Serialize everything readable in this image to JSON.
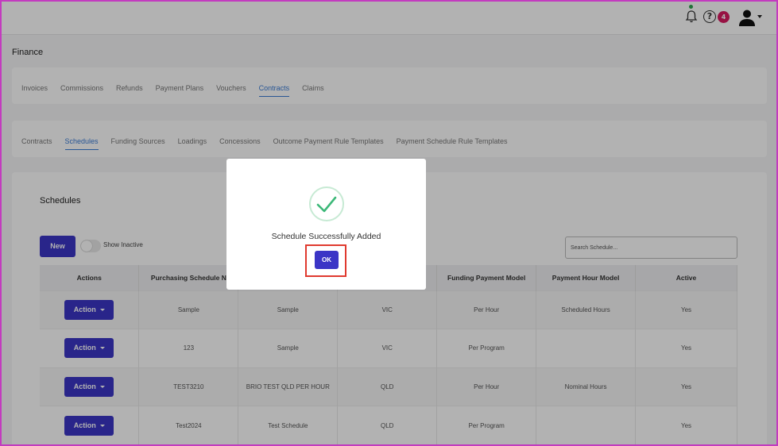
{
  "header": {
    "notification_count": "4"
  },
  "page": {
    "title": "Finance"
  },
  "primary_tabs": [
    {
      "label": "Invoices"
    },
    {
      "label": "Commissions"
    },
    {
      "label": "Refunds"
    },
    {
      "label": "Payment Plans"
    },
    {
      "label": "Vouchers"
    },
    {
      "label": "Contracts",
      "active": true
    },
    {
      "label": "Claims"
    }
  ],
  "secondary_tabs": [
    {
      "label": "Contracts"
    },
    {
      "label": "Schedules",
      "active": true
    },
    {
      "label": "Funding Sources"
    },
    {
      "label": "Loadings"
    },
    {
      "label": "Concessions"
    },
    {
      "label": "Outcome Payment Rule Templates"
    },
    {
      "label": "Payment Schedule Rule Templates"
    }
  ],
  "schedules": {
    "title": "Schedules",
    "new_label": "New",
    "show_inactive_label": "Show Inactive",
    "search_placeholder": "Search Schedule...",
    "columns": [
      "Actions",
      "Purchasing Schedule N",
      "",
      "",
      "Funding Payment Model",
      "Payment Hour Model",
      "Active"
    ],
    "action_label": "Action",
    "rows": [
      [
        "Sample",
        "Sample",
        "VIC",
        "Per Hour",
        "Scheduled Hours",
        "Yes"
      ],
      [
        "123",
        "Sample",
        "VIC",
        "Per Program",
        "",
        "Yes"
      ],
      [
        "TEST3210",
        "BRIO TEST QLD PER HOUR",
        "QLD",
        "Per Hour",
        "Nominal Hours",
        "Yes"
      ],
      [
        "Test2024",
        "Test Schedule",
        "QLD",
        "Per Program",
        "",
        "Yes"
      ]
    ]
  },
  "modal": {
    "message": "Schedule Successfully Added",
    "ok_label": "OK"
  },
  "colors": {
    "primary": "#3b35c6",
    "active_tab": "#3a7bd5",
    "badge": "#d81b60",
    "success": "#3cb878",
    "highlight": "#e03a2f"
  }
}
